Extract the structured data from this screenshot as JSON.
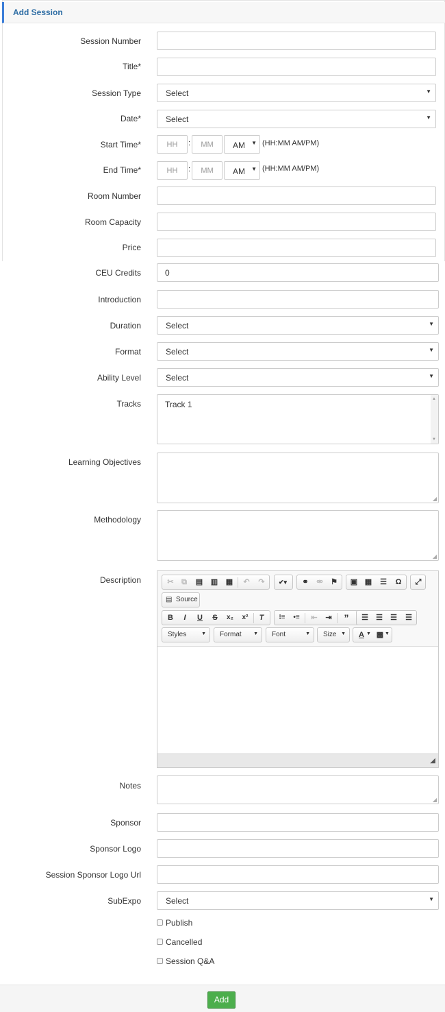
{
  "header": {
    "title": "Add Session"
  },
  "fields": {
    "session_number": {
      "label": "Session Number",
      "value": ""
    },
    "title": {
      "label": "Title*",
      "value": ""
    },
    "session_type": {
      "label": "Session Type",
      "value": "Select"
    },
    "date": {
      "label": "Date*",
      "value": "Select"
    },
    "start_time": {
      "label": "Start Time*",
      "hh": "HH",
      "mm": "MM",
      "ampm": "AM",
      "hint": "(HH:MM AM/PM)"
    },
    "end_time": {
      "label": "End Time*",
      "hh": "HH",
      "mm": "MM",
      "ampm": "AM",
      "hint": "(HH:MM AM/PM)"
    },
    "room_number": {
      "label": "Room Number",
      "value": ""
    },
    "room_capacity": {
      "label": "Room Capacity",
      "value": ""
    },
    "price": {
      "label": "Price",
      "value": ""
    },
    "ceu_credits": {
      "label": "CEU Credits",
      "value": "0"
    },
    "introduction": {
      "label": "Introduction",
      "value": ""
    },
    "duration": {
      "label": "Duration",
      "value": "Select"
    },
    "format": {
      "label": "Format",
      "value": "Select"
    },
    "ability_level": {
      "label": "Ability Level",
      "value": "Select"
    },
    "tracks": {
      "label": "Tracks",
      "value": "Track 1"
    },
    "learning_objectives": {
      "label": "Learning Objectives",
      "value": ""
    },
    "methodology": {
      "label": "Methodology",
      "value": ""
    },
    "description": {
      "label": "Description"
    },
    "notes": {
      "label": "Notes",
      "value": ""
    },
    "sponsor": {
      "label": "Sponsor",
      "value": ""
    },
    "sponsor_logo": {
      "label": "Sponsor Logo",
      "value": ""
    },
    "sponsor_logo_url": {
      "label": "Session Sponsor Logo Url",
      "value": ""
    },
    "subexpo": {
      "label": "SubExpo",
      "value": "Select"
    }
  },
  "editor": {
    "source_label": "Source",
    "combos": {
      "styles": "Styles",
      "format": "Format",
      "font": "Font",
      "size": "Size"
    },
    "icons": [
      "cut-icon",
      "copy-icon",
      "paste-icon",
      "paste-text-icon",
      "paste-word-icon",
      "undo-icon",
      "redo-icon",
      "spellcheck-icon",
      "link-icon",
      "unlink-icon",
      "anchor-icon",
      "image-icon",
      "table-icon",
      "horizontal-rule-icon",
      "special-char-icon",
      "maximize-icon",
      "bold-icon",
      "italic-icon",
      "underline-icon",
      "strike-icon",
      "subscript-icon",
      "superscript-icon",
      "remove-format-icon",
      "numbered-list-icon",
      "bulleted-list-icon",
      "outdent-icon",
      "indent-icon",
      "blockquote-icon",
      "align-left-icon",
      "align-center-icon",
      "align-right-icon",
      "justify-icon",
      "text-color-icon",
      "bg-color-icon"
    ]
  },
  "checkboxes": {
    "publish": "Publish",
    "cancelled": "Cancelled",
    "session_qa": "Session Q&A"
  },
  "actions": {
    "add": "Add"
  },
  "colors": {
    "accent": "#3b7dd8",
    "add_button": "#4cae4c"
  }
}
